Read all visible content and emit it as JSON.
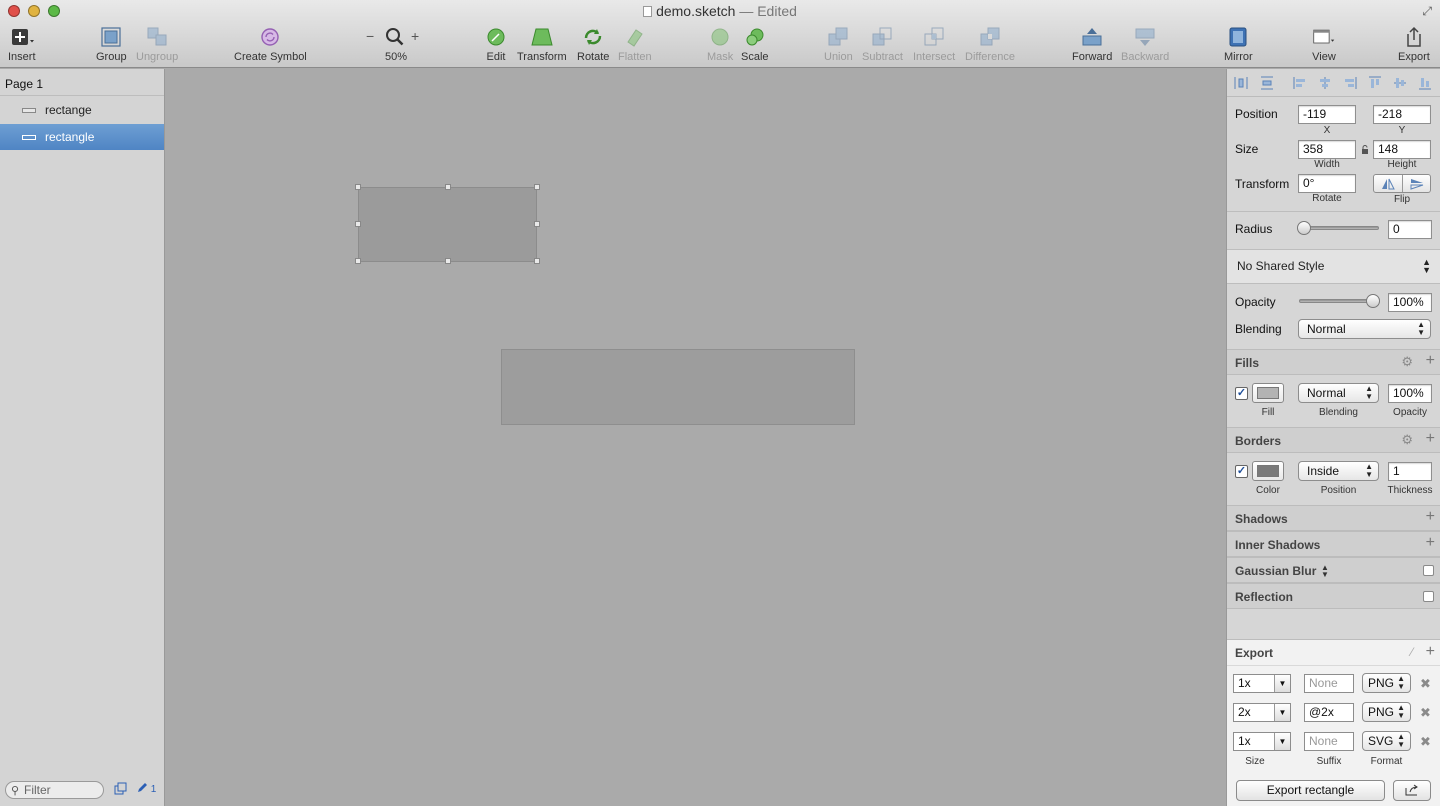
{
  "window": {
    "title": "demo.sketch",
    "title_suffix": "— Edited"
  },
  "toolbar": {
    "insert": "Insert",
    "group": "Group",
    "ungroup": "Ungroup",
    "create_symbol": "Create Symbol",
    "zoom_level": "50%",
    "zoom_out": "−",
    "zoom_in": "+",
    "edit": "Edit",
    "transform": "Transform",
    "rotate": "Rotate",
    "flatten": "Flatten",
    "mask": "Mask",
    "scale": "Scale",
    "union": "Union",
    "subtract": "Subtract",
    "intersect": "Intersect",
    "difference": "Difference",
    "forward": "Forward",
    "backward": "Backward",
    "mirror": "Mirror",
    "view": "View",
    "export": "Export"
  },
  "layers": {
    "page": "Page 1",
    "items": [
      {
        "label": "rectange",
        "selected": false
      },
      {
        "label": "rectangle",
        "selected": true
      }
    ],
    "filter_placeholder": "Filter",
    "selected_count": "1"
  },
  "inspector": {
    "position_label": "Position",
    "x": "-119",
    "y": "-218",
    "x_label": "X",
    "y_label": "Y",
    "size_label": "Size",
    "width": "358",
    "height": "148",
    "width_label": "Width",
    "height_label": "Height",
    "transform_label": "Transform",
    "rotate_value": "0°",
    "rotate_label": "Rotate",
    "flip_label": "Flip",
    "radius_label": "Radius",
    "radius_value": "0",
    "shared_style": "No Shared Style",
    "opacity_label": "Opacity",
    "opacity_value": "100%",
    "opacity_level": 1.0,
    "blending_label": "Blending",
    "blending_value": "Normal",
    "fills": {
      "title": "Fills",
      "blend": "Normal",
      "opacity": "100%",
      "fill_label": "Fill",
      "blending_label": "Blending",
      "opacity_label": "Opacity",
      "color": "#b3b3b3"
    },
    "borders": {
      "title": "Borders",
      "position": "Inside",
      "thickness": "1",
      "color_label": "Color",
      "position_label": "Position",
      "thickness_label": "Thickness",
      "color": "#7a7a7a"
    },
    "shadows": "Shadows",
    "inner_shadows": "Inner Shadows",
    "gaussian_blur": "Gaussian Blur",
    "reflection": "Reflection"
  },
  "export": {
    "title": "Export",
    "rows": [
      {
        "size": "1x",
        "suffix": "",
        "suffix_placeholder": "None",
        "format": "PNG"
      },
      {
        "size": "2x",
        "suffix": "@2x",
        "suffix_placeholder": "None",
        "format": "PNG"
      },
      {
        "size": "1x",
        "suffix": "",
        "suffix_placeholder": "None",
        "format": "SVG"
      }
    ],
    "size_label": "Size",
    "suffix_label": "Suffix",
    "format_label": "Format",
    "button_label": "Export rectangle"
  },
  "colors": {
    "accent": "#4f85c4",
    "canvas": "#aaaaaa"
  }
}
